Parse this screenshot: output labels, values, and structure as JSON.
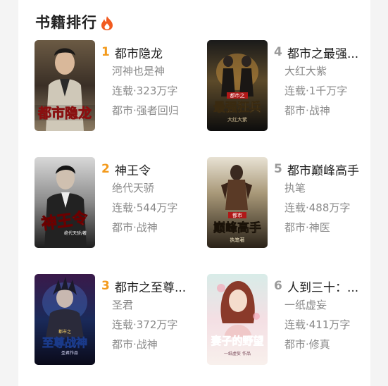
{
  "section": {
    "title": "书籍排行",
    "icon": "fire-icon"
  },
  "books": [
    {
      "rank": "1",
      "title": "都市隐龙",
      "author": "河神也是神",
      "status": "连载·323万字",
      "genre": "都市·强者回归",
      "cover_text": "都市隐龙",
      "rank_color": "#f39a1c"
    },
    {
      "rank": "4",
      "title": "都市之最强狂兵",
      "title_display": "都市之最强...",
      "author": "大红大紫",
      "status": "连载·1千万字",
      "genre": "都市·战神",
      "cover_text": "都市之最强狂兵",
      "cover_author": "大红大紫",
      "rank_color": "#9a9a9a"
    },
    {
      "rank": "2",
      "title": "神王令",
      "author": "绝代天骄",
      "status": "连载·544万字",
      "genre": "都市·战神",
      "cover_text": "神王令",
      "cover_author": "绝代天骄/著",
      "rank_color": "#f39a1c"
    },
    {
      "rank": "5",
      "title": "都市巅峰高手",
      "author": "执笔",
      "status": "连载·488万字",
      "genre": "都市·神医",
      "cover_text": "都市巅峰高手",
      "cover_author": "执笔著",
      "rank_color": "#9a9a9a"
    },
    {
      "rank": "3",
      "title": "都市之至尊战神",
      "title_display": "都市之至尊...",
      "author": "圣君",
      "status": "连载·372万字",
      "genre": "都市·战神",
      "cover_text": "都市之至尊战神",
      "cover_author": "圣君作品",
      "rank_color": "#f39a1c"
    },
    {
      "rank": "6",
      "title": "人到三十：妻子的野望",
      "title_display": "人到三十：...",
      "author": "一纸虚妄",
      "status": "连载·411万字",
      "genre": "都市·修真",
      "cover_text": "妻子的野望",
      "cover_author": "一纸虚妄 作品",
      "rank_color": "#9a9a9a"
    }
  ]
}
